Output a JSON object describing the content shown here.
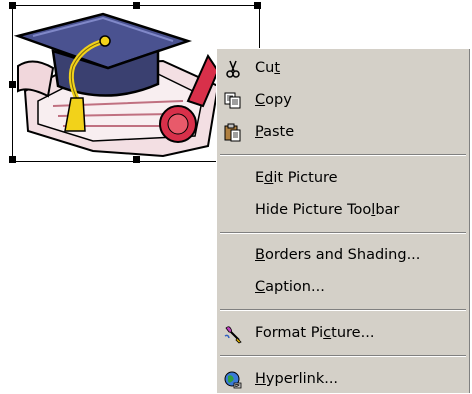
{
  "picture": {
    "name": "graduation-clipart"
  },
  "menu": {
    "items": [
      {
        "id": "cut",
        "label": "Cut",
        "mnemonic_index": 2,
        "icon": "scissors-icon"
      },
      {
        "id": "copy",
        "label": "Copy",
        "mnemonic_index": 0,
        "icon": "copy-icon"
      },
      {
        "id": "paste",
        "label": "Paste",
        "mnemonic_index": 0,
        "icon": "paste-icon"
      },
      {
        "id": "edit-picture",
        "label": "Edit Picture",
        "mnemonic_index": 1,
        "icon": null
      },
      {
        "id": "hide-picture-toolbar",
        "label": "Hide Picture Toolbar",
        "mnemonic_index": 16,
        "icon": null
      },
      {
        "id": "borders-and-shading",
        "label": "Borders and Shading...",
        "mnemonic_index": 0,
        "icon": null
      },
      {
        "id": "caption",
        "label": "Caption...",
        "mnemonic_index": 0,
        "icon": null
      },
      {
        "id": "format-picture",
        "label": "Format Picture...",
        "mnemonic_index": 9,
        "icon": "format-picture-icon"
      },
      {
        "id": "hyperlink",
        "label": "Hyperlink...",
        "mnemonic_index": 0,
        "icon": "hyperlink-icon"
      }
    ]
  },
  "colors": {
    "menu_bg": "#d4d0c8",
    "cap": "#4a5290",
    "tassel": "#f2d21a",
    "seal": "#d8304a",
    "diploma": "#f1d7dc"
  }
}
